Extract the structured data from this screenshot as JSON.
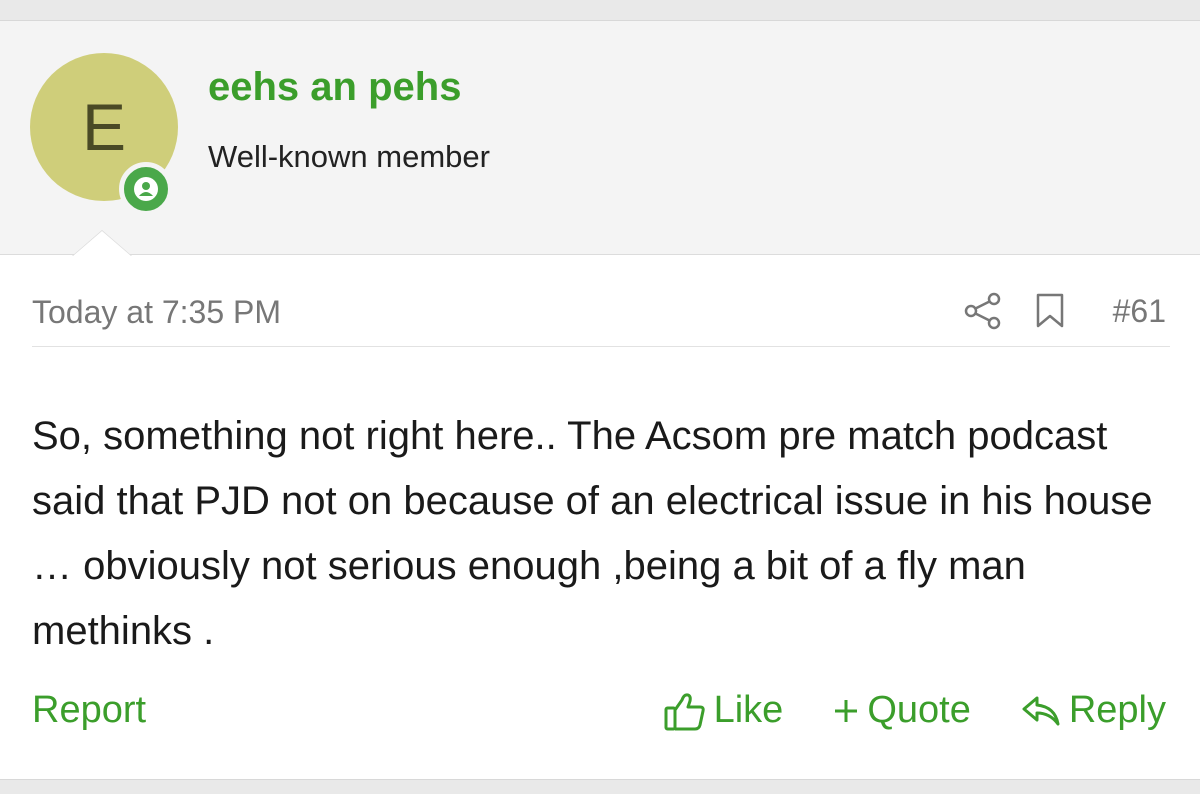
{
  "user": {
    "avatar_letter": "E",
    "name": "eehs an pehs",
    "title": "Well-known member",
    "avatar_color": "#cfce7a",
    "online_badge_color": "#4aa84a"
  },
  "post": {
    "timestamp": "Today at 7:35 PM",
    "number": "#61",
    "message": "So, something not right here.. The Acsom pre match podcast said that PJD not on because of an electrical issue in his house … obviously not serious enough ,being a bit of a fly man methinks ."
  },
  "actions": {
    "report": "Report",
    "like": "Like",
    "quote": "Quote",
    "reply": "Reply"
  },
  "colors": {
    "accent": "#3b9e2b",
    "meta_text": "#777777"
  },
  "icons": {
    "share": "share-icon",
    "bookmark": "bookmark-icon",
    "like": "thumbs-up-icon",
    "quote": "plus-icon",
    "reply": "reply-arrow-icon",
    "online": "user-online-icon"
  }
}
